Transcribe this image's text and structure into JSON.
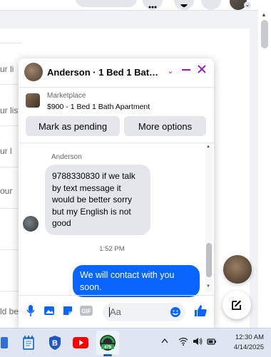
{
  "background_page": {
    "fragments": [
      "ur li",
      "ur listi",
      "ur l",
      "our",
      "ld be"
    ]
  },
  "chat": {
    "title": "Anderson · 1 Bed 1 Bath A...",
    "marketplace_label": "Marketplace",
    "listing": "$900 - 1 Bed 1 Bath Apartment",
    "buttons": {
      "pending": "Mark as pending",
      "more": "More options"
    },
    "sender_name": "Anderson",
    "incoming_message": "9788330830 if we talk by text message it would be better sorry but my English is not good",
    "timestamp": "1:52 PM",
    "outgoing_message": "We will contact with you soon.",
    "composer_placeholder": "Aa",
    "accent_color": "#0866ff",
    "header_icon_color": "#a020c0"
  },
  "taskbar": {
    "app_badge": "479",
    "time": "12:30 AM",
    "date": "4/14/2025"
  }
}
